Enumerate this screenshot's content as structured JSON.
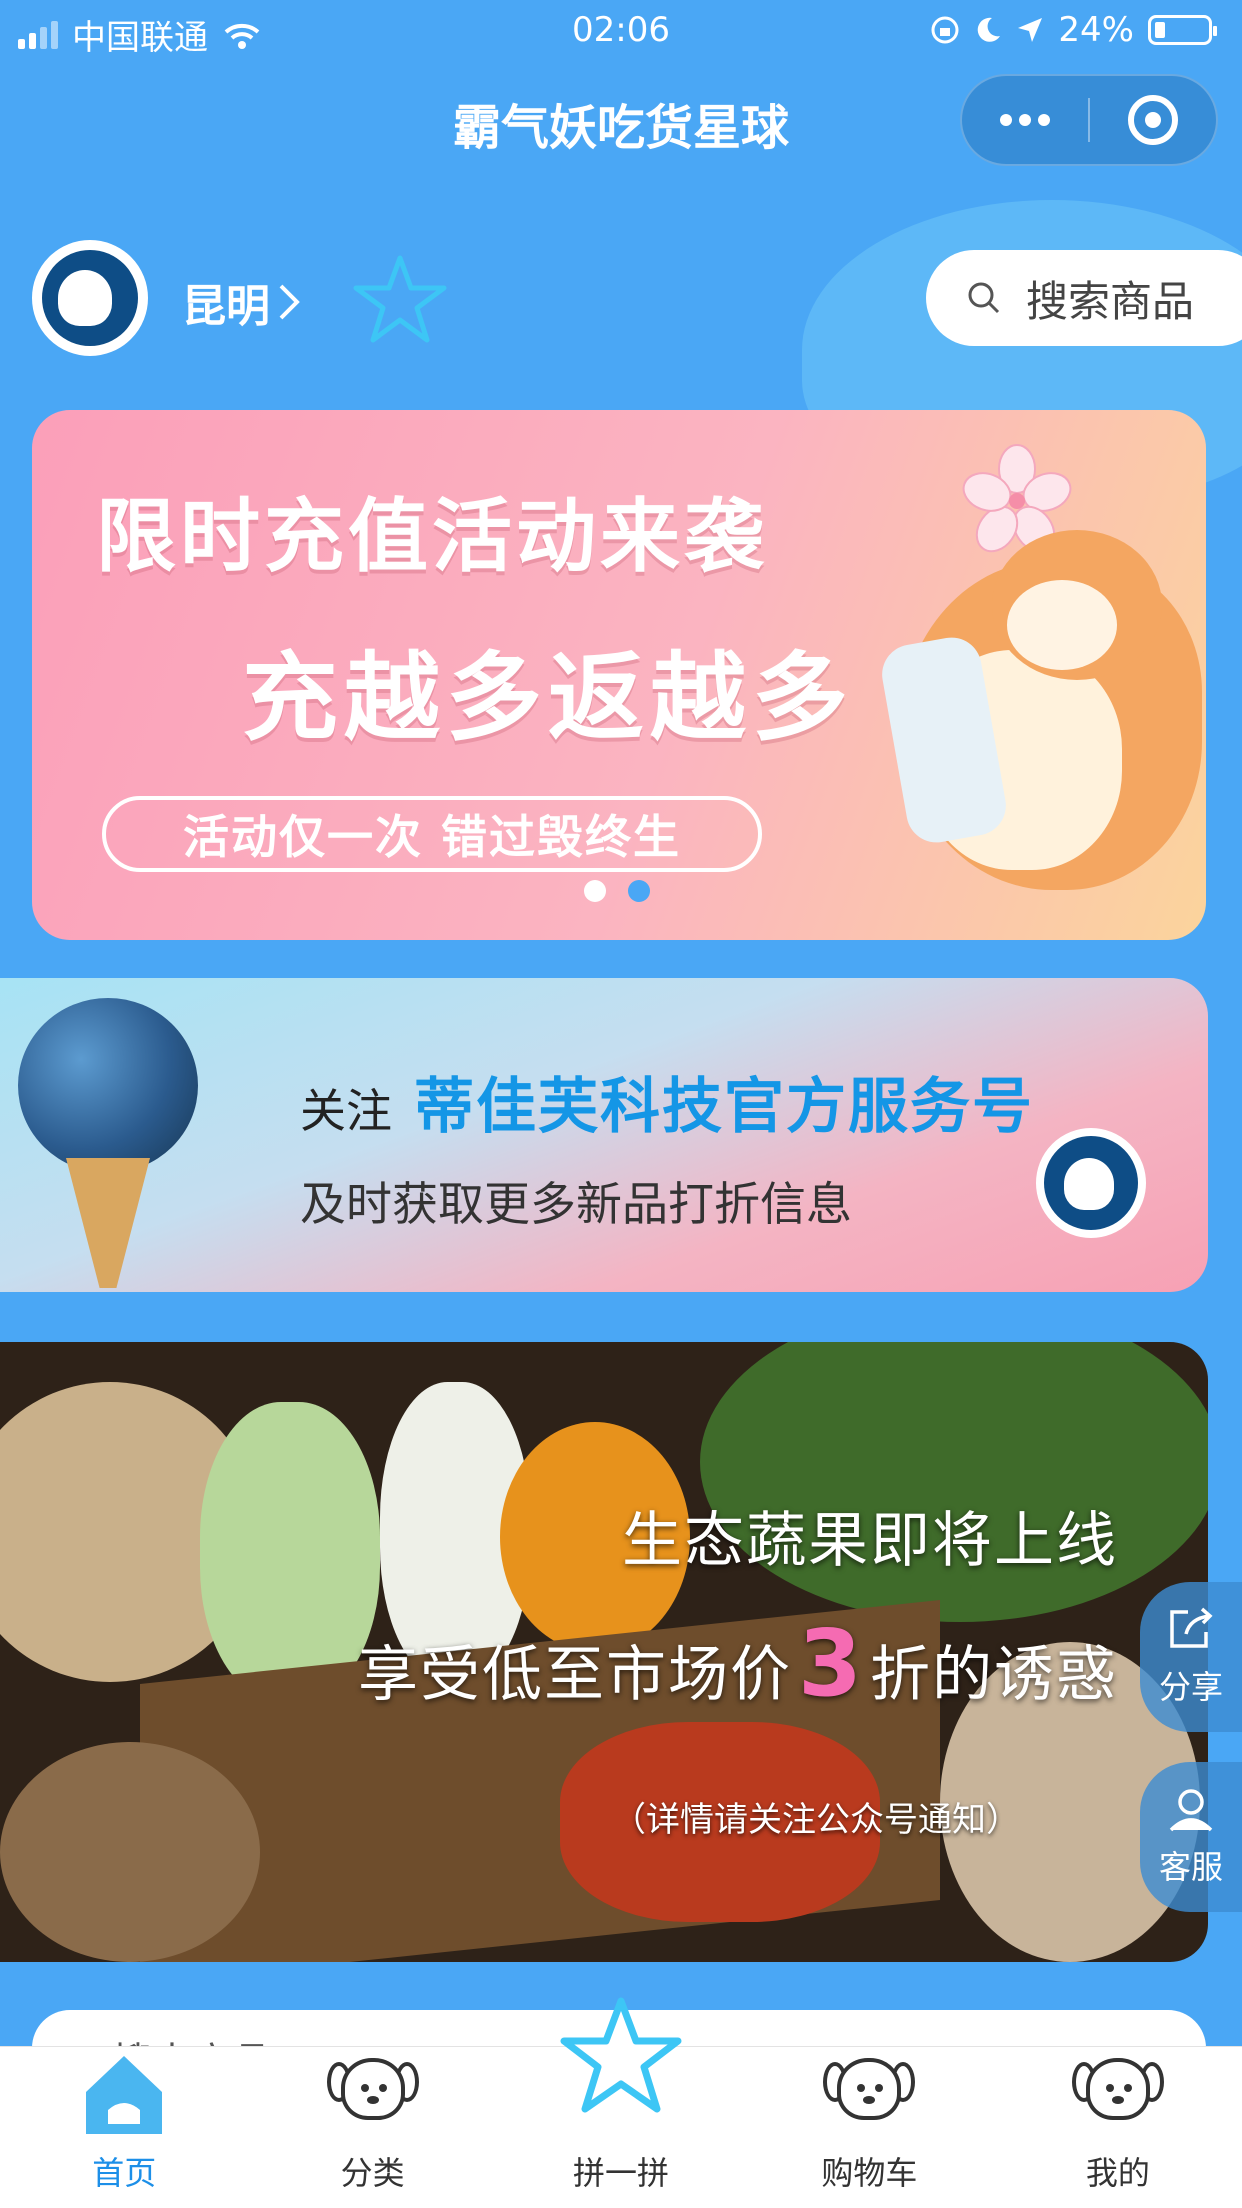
{
  "status_bar": {
    "carrier": "中国联通",
    "time": "02:06",
    "battery": "24%"
  },
  "nav": {
    "title": "霸气妖吃货星球",
    "more_icon": "more-dots-icon",
    "close_icon": "target-circle-icon"
  },
  "header": {
    "city": "昆明",
    "search_placeholder": "搜索商品"
  },
  "banner": {
    "line1": "限时充值活动来袭",
    "line2": "充越多返越多",
    "pill": "活动仅一次  错过毁终生",
    "slides_total": 2,
    "active_slide": 2,
    "accent": "#4aa7f5"
  },
  "follow_card": {
    "prefix": "关注",
    "brand": "蒂佳芙科技官方服务号",
    "subtitle": "及时获取更多新品打折信息"
  },
  "veg_card": {
    "line1": "生态蔬果即将上线",
    "line2_pre": "享受低至市场价",
    "line2_num": "3",
    "line2_post": "折的诱惑",
    "note": "（详情请关注公众号通知）"
  },
  "floating": {
    "share": "分享",
    "service": "客服"
  },
  "peek": {
    "text": "搜索商品"
  },
  "tabs": [
    {
      "label": "首页",
      "icon": "home-icon",
      "active": true
    },
    {
      "label": "分类",
      "icon": "category-dog-icon",
      "active": false
    },
    {
      "label": "拼一拼",
      "icon": "star-icon",
      "active": false
    },
    {
      "label": "购物车",
      "icon": "cart-dog-icon",
      "active": false
    },
    {
      "label": "我的",
      "icon": "profile-dog-icon",
      "active": false
    }
  ],
  "colors": {
    "background": "#4aa7f5",
    "tab_active": "#1c8fe8",
    "brand_text": "#1496e6",
    "highlight": "#f56bb2"
  }
}
